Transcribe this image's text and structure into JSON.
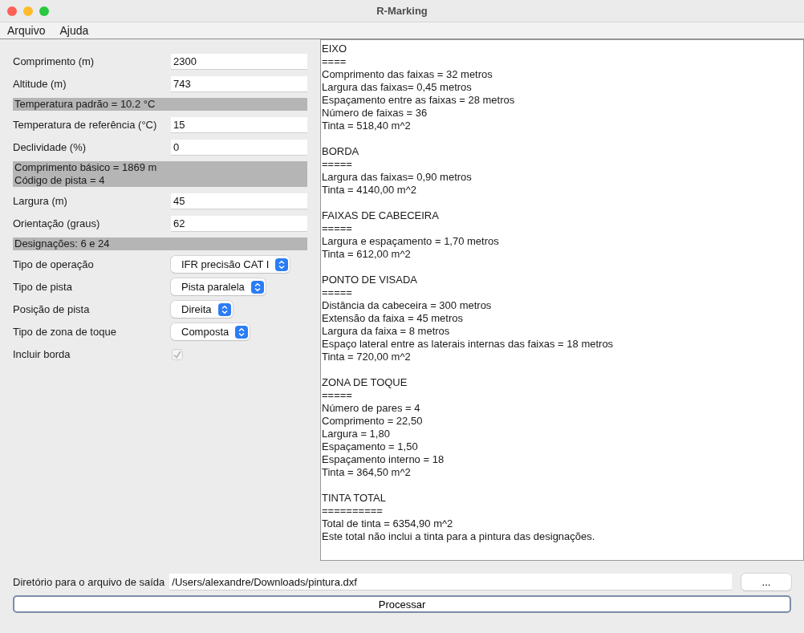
{
  "window": {
    "title": "R-Marking"
  },
  "menu": [
    "Arquivo",
    "Ajuda"
  ],
  "form": [
    {
      "kind": "field",
      "label": "Comprimento (m)",
      "value": "2300"
    },
    {
      "kind": "field",
      "label": "Altitude (m)",
      "value": "743"
    },
    {
      "kind": "info",
      "lines": [
        "Temperatura padrão = 10.2 °C"
      ]
    },
    {
      "kind": "field",
      "label": "Temperatura de referência (°C)",
      "value": "15"
    },
    {
      "kind": "field",
      "label": "Declividade (%)",
      "value": "0"
    },
    {
      "kind": "info",
      "lines": [
        "Comprimento básico = 1869 m",
        "Código de pista = 4"
      ]
    },
    {
      "kind": "field",
      "label": "Largura (m)",
      "value": "45"
    },
    {
      "kind": "field",
      "label": "Orientação (graus)",
      "value": "62"
    },
    {
      "kind": "info",
      "lines": [
        "Designações: 6 e 24"
      ]
    },
    {
      "kind": "select",
      "label": "Tipo de operação",
      "value": "IFR precisão CAT I"
    },
    {
      "kind": "select",
      "label": "Tipo de pista",
      "value": "Pista paralela"
    },
    {
      "kind": "select",
      "label": "Posição de pista",
      "value": "Direita"
    },
    {
      "kind": "select",
      "label": "Tipo de zona de toque",
      "value": "Composta"
    },
    {
      "kind": "checkbox",
      "label": "Incluir borda",
      "checked": true,
      "disabled": true
    }
  ],
  "output": [
    [
      "EIXO",
      "====",
      "Comprimento das faixas = 32 metros",
      "Largura das faixas= 0,45 metros",
      "Espaçamento entre as faixas = 28 metros",
      "Número de faixas = 36",
      "Tinta = 518,40 m^2"
    ],
    [
      "BORDA",
      "=====",
      "Largura das faixas= 0,90 metros",
      "Tinta = 4140,00 m^2"
    ],
    [
      "FAIXAS DE CABECEIRA",
      "=====",
      "Largura e espaçamento = 1,70 metros",
      "Tinta = 612,00 m^2"
    ],
    [
      "PONTO DE VISADA",
      "=====",
      "Distância da cabeceira = 300 metros",
      "Extensão da faixa = 45 metros",
      "Largura da faixa = 8 metros",
      "Espaço lateral entre as laterais internas das faixas = 18 metros",
      "Tinta = 720,00 m^2"
    ],
    [
      "ZONA DE TOQUE",
      "=====",
      "Número de pares = 4",
      "Comprimento = 22,50",
      "Largura = 1,80",
      "Espaçamento = 1,50",
      "Espaçamento interno = 18",
      "Tinta = 364,50 m^2"
    ],
    [
      "TINTA TOTAL",
      "==========",
      "Total de tinta = 6354,90 m^2",
      "Este total não inclui a tinta para a pintura das designações."
    ]
  ],
  "output_path": {
    "label": "Diretório para o arquivo de saída",
    "value": "/Users/alexandre/Downloads/pintura.dxf",
    "browse": "..."
  },
  "process_button": "Processar"
}
